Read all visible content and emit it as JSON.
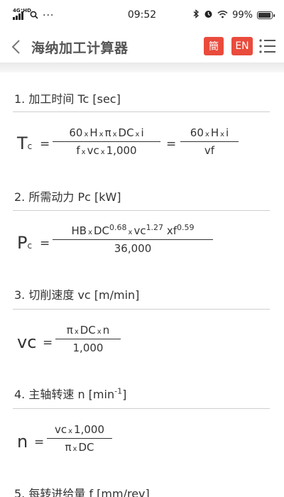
{
  "status_bar": {
    "network_tag": "4G⁺HD",
    "time": "09:52",
    "battery": "99%",
    "battery_level": 0.99
  },
  "header": {
    "title": "海纳加工计算器",
    "lang_zh": "簡",
    "lang_en": "EN"
  },
  "sections": [
    {
      "title": "1. 加工时间 Tc [sec]",
      "var_main": "T",
      "var_sub": "c",
      "frac1_num": [
        "60",
        "H",
        "π",
        "DC",
        "i"
      ],
      "frac1_den": [
        "f",
        "vc",
        "1,000"
      ],
      "frac2_num": [
        "60",
        "H",
        "i"
      ],
      "frac2_den": "vf"
    },
    {
      "title": "2. 所需动力 Pc [kW]",
      "var_main": "P",
      "var_sub": "c",
      "num_hb": "HB",
      "num_dc": "DC",
      "exp1": "0.68",
      "num_vc": "vc",
      "exp2": "1.27",
      "num_xf": "xf",
      "exp3": "0.59",
      "den": "36,000"
    },
    {
      "title": "3. 切削速度 vc [m/min]",
      "var_main": "vc",
      "num": [
        "π",
        "DC",
        "n"
      ],
      "den": "1,000"
    },
    {
      "title_main": "4. 主轴转速 n [min",
      "title_exp": "-1",
      "title_end": "]",
      "var_main": "n",
      "num": [
        "vc",
        "1,000"
      ],
      "den": [
        "π",
        "DC"
      ]
    },
    {
      "title": "5. 每转进给量 f [mm/rev]"
    }
  ],
  "symbols": {
    "times": "x",
    "equals": "="
  },
  "colors": {
    "accent": "#e94b3c",
    "text": "#333333",
    "rule": "#cfcfcf"
  }
}
